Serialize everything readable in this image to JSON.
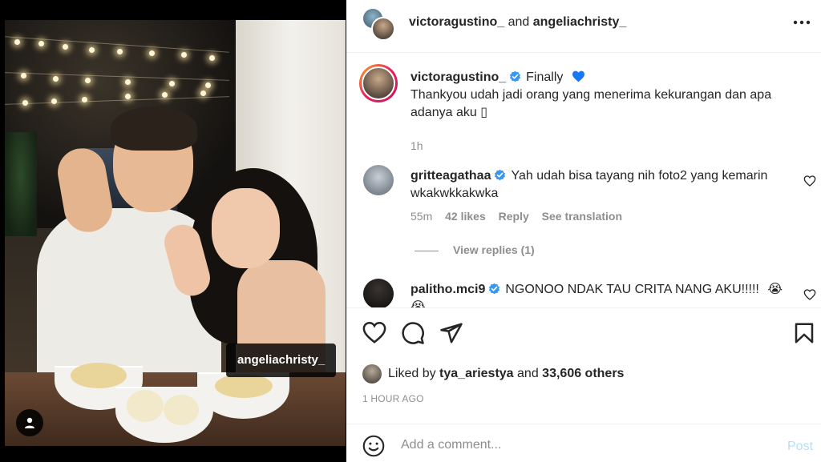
{
  "header": {
    "user1": "victoragustino_",
    "joiner": "and",
    "user2": "angeliachristy_"
  },
  "media": {
    "tag_label": "angeliachristy_"
  },
  "caption": {
    "username": "victoragustino_",
    "first_line": "Finally",
    "body": "Thankyou udah jadi orang yang menerima kekurangan dan apa adanya aku ",
    "trailing_glyph": "▯",
    "time": "1h"
  },
  "comments": [
    {
      "username": "gritteagathaa",
      "text": "Yah udah bisa tayang nih foto2 yang kemarin wkakwkkakwka",
      "time": "55m",
      "likes": "42 likes",
      "reply": "Reply",
      "see_translation": "See translation",
      "view_replies": "View replies (1)"
    },
    {
      "username": "palitho.mci9",
      "text": "NGONOO NDAK TAU CRITA NANG AKU!!!!!",
      "emoji": "😭"
    }
  ],
  "likes": {
    "prefix": "Liked by",
    "user": "tya_ariestya",
    "and": "and",
    "others": "33,606 others"
  },
  "time_ago": "1 HOUR AGO",
  "add_comment": {
    "placeholder": "Add a comment...",
    "post_label": "Post"
  },
  "colors": {
    "verified": "#3897f0",
    "post_disabled": "#b2dffc",
    "story_ring_start": "#f9a825",
    "story_ring_end": "#c2185b",
    "heart_blue": "#1877f2"
  },
  "icons": {
    "more": "more-icon",
    "like": "heart-icon",
    "comment": "comment-icon",
    "share": "send-icon",
    "save": "bookmark-icon",
    "emoji": "emoji-icon",
    "user_tag": "user-tag-icon"
  }
}
